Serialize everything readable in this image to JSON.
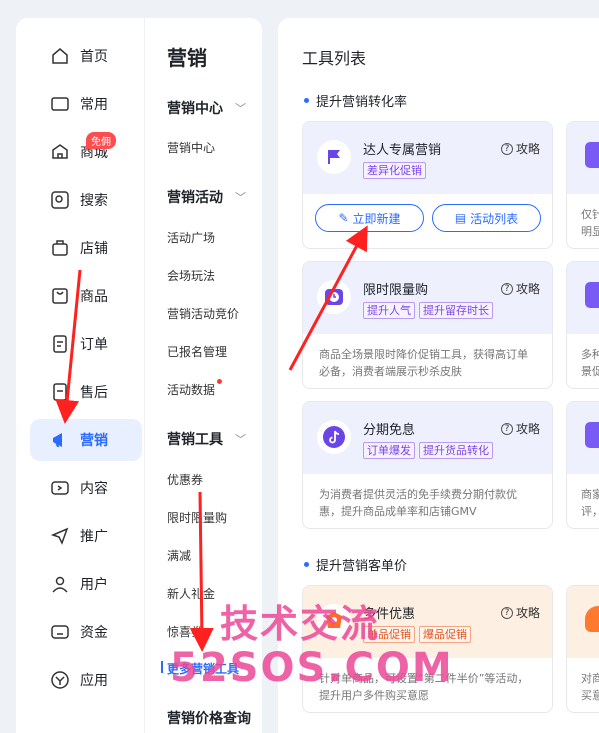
{
  "nav": {
    "items": [
      {
        "label": "首页",
        "icon": "home-icon"
      },
      {
        "label": "常用",
        "icon": "folder-icon"
      },
      {
        "label": "商城",
        "icon": "shop-icon"
      },
      {
        "label": "搜索",
        "icon": "search-icon"
      },
      {
        "label": "店铺",
        "icon": "store-icon"
      },
      {
        "label": "商品",
        "icon": "bag-icon"
      },
      {
        "label": "订单",
        "icon": "order-icon"
      },
      {
        "label": "售后",
        "icon": "aftersale-icon"
      },
      {
        "label": "营销",
        "icon": "megaphone-icon"
      },
      {
        "label": "内容",
        "icon": "tv-icon"
      },
      {
        "label": "推广",
        "icon": "send-icon"
      },
      {
        "label": "用户",
        "icon": "user-icon"
      },
      {
        "label": "资金",
        "icon": "wallet-icon"
      },
      {
        "label": "应用",
        "icon": "app-icon"
      }
    ],
    "badge": "免佣",
    "active_color": "#2b6bff"
  },
  "submenu": {
    "title": "营销",
    "groups": [
      {
        "label": "营销中心",
        "items": [
          "营销中心"
        ]
      },
      {
        "label": "营销活动",
        "items": [
          "活动广场",
          "会场玩法",
          "营销活动竞价",
          "已报名管理",
          "活动数据"
        ]
      },
      {
        "label": "营销工具",
        "items": [
          "优惠券",
          "限时限量购",
          "满减",
          "新人礼金",
          "惊喜券",
          "更多营销工具"
        ]
      },
      {
        "label": "营销价格查询",
        "items": []
      }
    ]
  },
  "main": {
    "title": "工具列表",
    "sections": [
      {
        "title": "提升营销转化率"
      },
      {
        "title": "提升营销客单价"
      }
    ],
    "cards": [
      {
        "name": "达人专属营销",
        "tags": [
          "差异化促销"
        ],
        "guide": "攻略",
        "buttons": [
          "立即新建",
          "活动列表"
        ],
        "icon": "flag-icon"
      },
      {
        "name": "限时限量购",
        "tags": [
          "提升人气",
          "提升留存时长"
        ],
        "guide": "攻略",
        "desc": "商品全场景限时降价促销工具，获得高订单必备，消费者端展示秒杀皮肤",
        "icon": "clock-icon"
      },
      {
        "name": "分期免息",
        "tags": [
          "订单爆发",
          "提升货品转化"
        ],
        "guide": "攻略",
        "desc": "为消费者提供灵活的免手续费分期付款优惠，提升商品成单率和店铺GMV",
        "icon": "douyin-icon"
      },
      {
        "name": "多件优惠",
        "tags": [
          "单品促销",
          "爆品促销"
        ],
        "guide": "攻略",
        "desc": "针对单商品，可设置“第二件半价”等活动，提升用户多件购买意愿",
        "icon": "gift-icon"
      }
    ],
    "peek": [
      "仅针\n明显",
      "多种\n景促",
      "商家\n评，",
      "对商\n买意"
    ]
  },
  "watermark": {
    "line1": "技术交流",
    "line2": "52SOS.COM"
  },
  "colors": {
    "accent": "#2b6bff",
    "tag_purple": "#7a46e6",
    "tag_orange": "#e5531f",
    "arrow_red": "#ff2020"
  }
}
